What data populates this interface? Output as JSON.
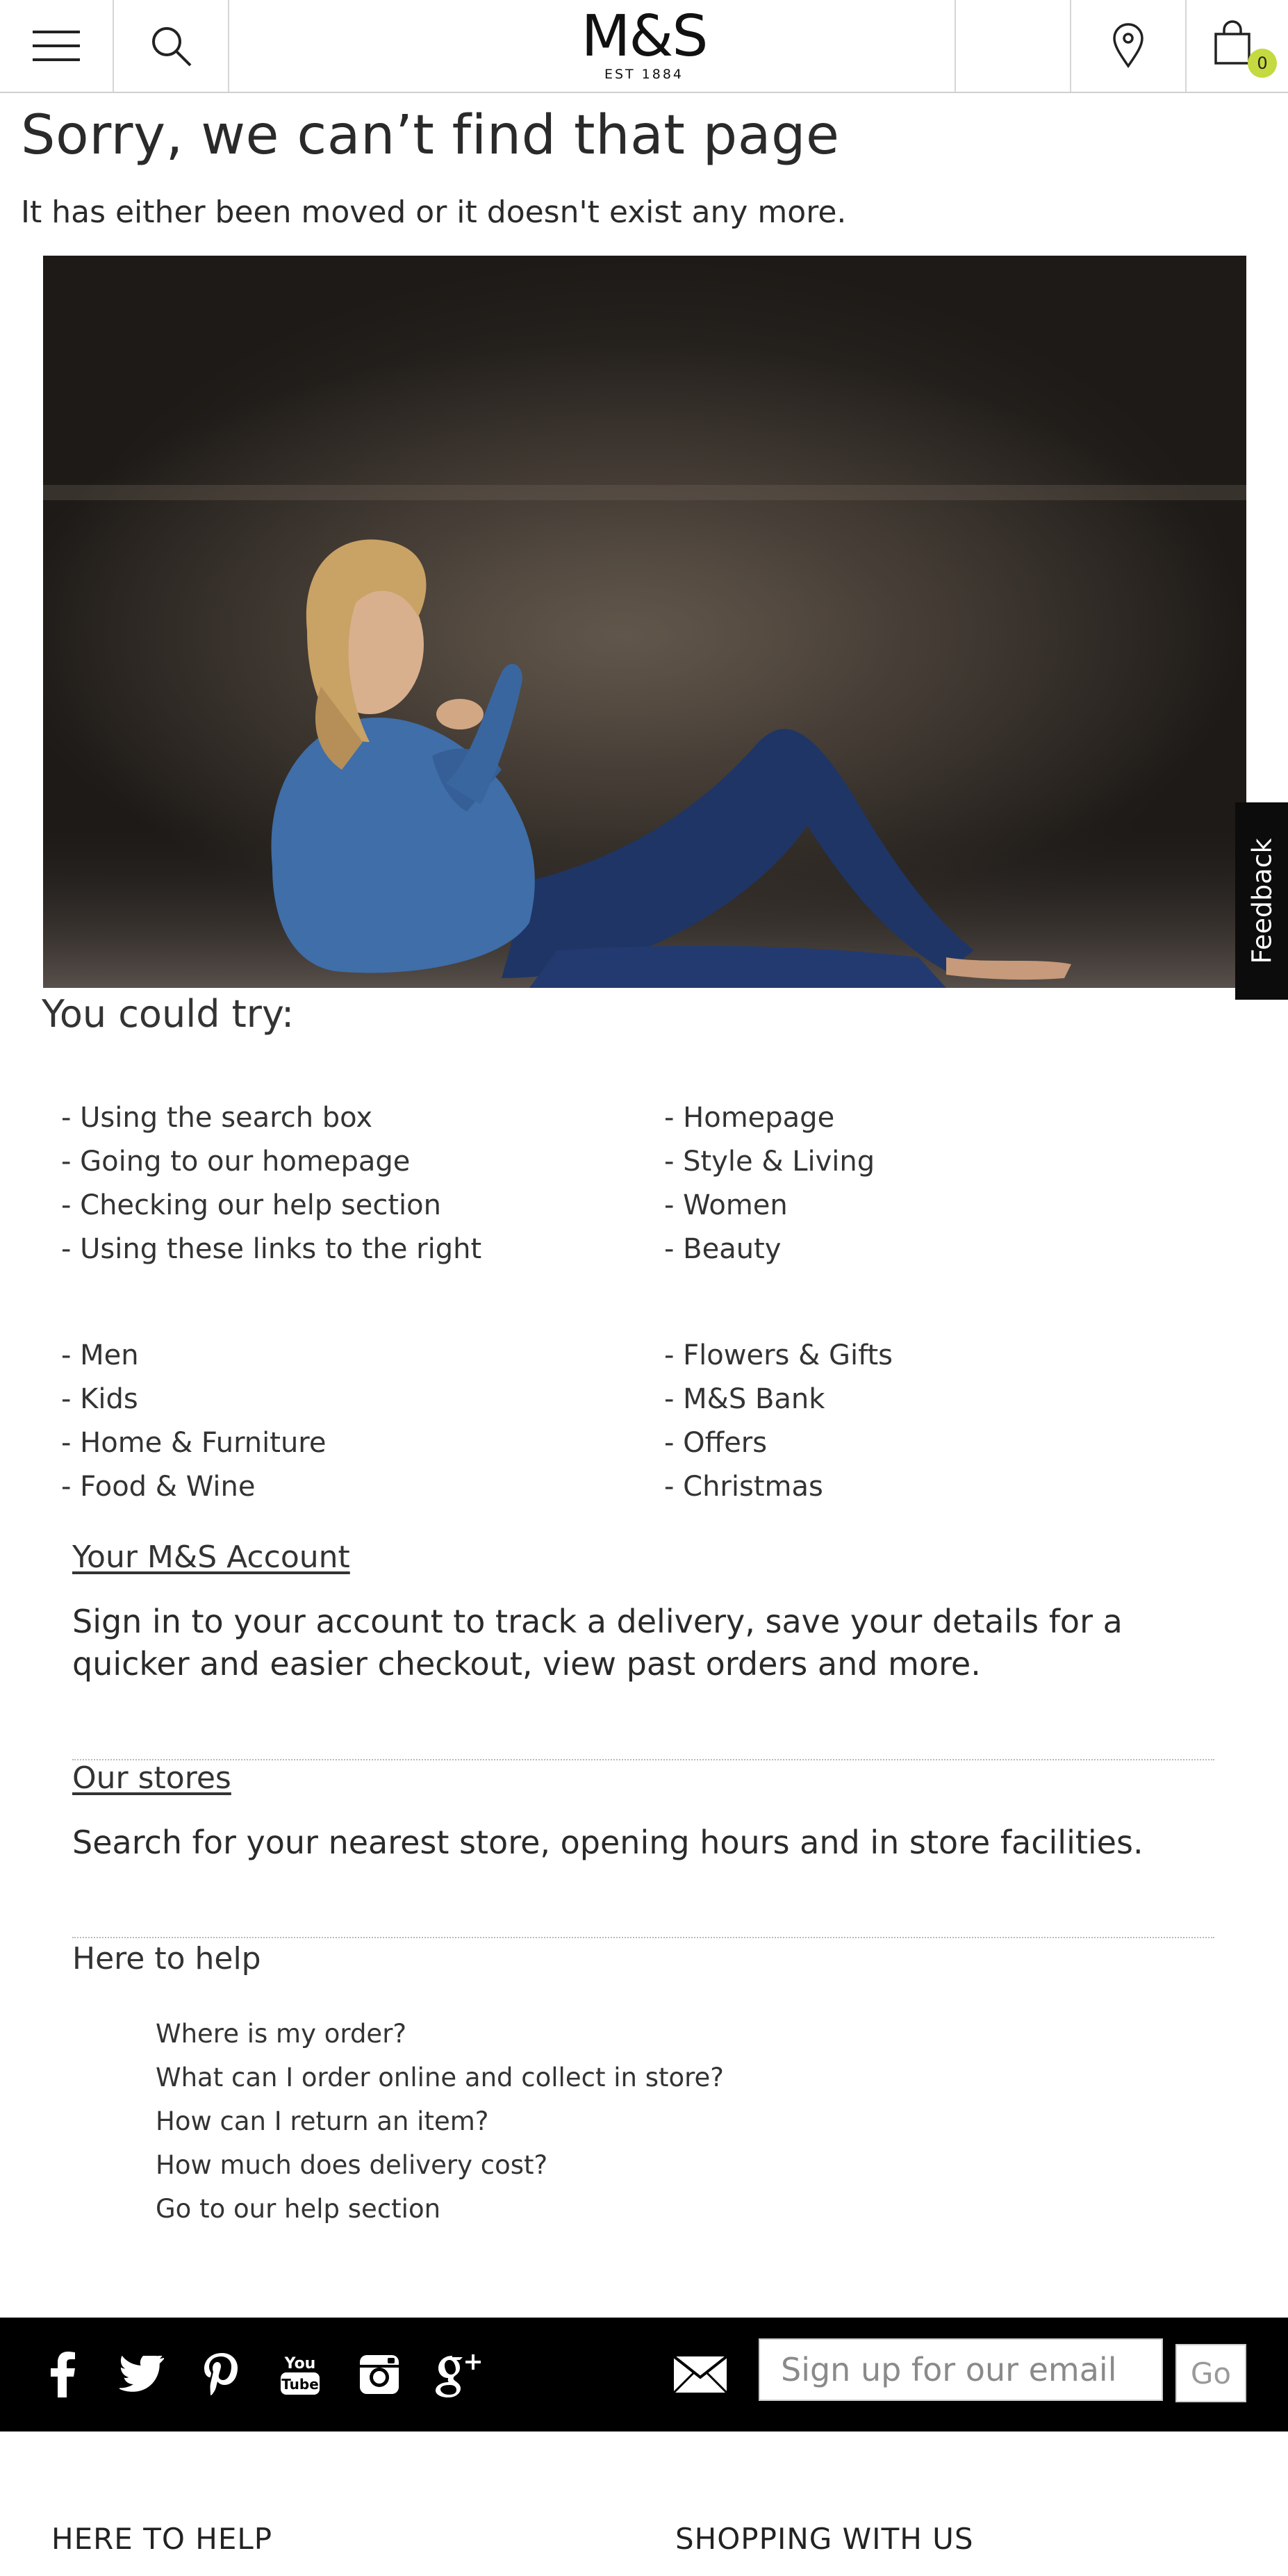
{
  "header": {
    "logo_main": "M&S",
    "logo_est": "EST 1884",
    "bag_count": "0",
    "icons": [
      "menu-icon",
      "search-icon",
      "store-locator-icon",
      "shopping-bag-icon"
    ]
  },
  "error": {
    "title": "Sorry, we can’t find that page",
    "subtitle": "It has either been moved or it doesn't exist any more."
  },
  "feedback_label": "Feedback",
  "suggestions": {
    "title": "You could try:",
    "tips": [
      "- Using the search box",
      "- Going to our homepage",
      "- Checking our help section",
      "- Using these links to the right"
    ],
    "links_a": [
      "- Homepage",
      "- Style & Living",
      "- Women",
      "- Beauty"
    ],
    "links_b": [
      "- Men",
      "- Kids",
      "- Home & Furniture",
      "- Food & Wine"
    ],
    "links_c": [
      "- Flowers & Gifts",
      "- M&S Bank",
      "- Offers",
      "- Christmas"
    ]
  },
  "account": {
    "title": "Your M&S Account",
    "text": "Sign in to your account to track a delivery, save your details for a quicker and easier checkout, view past orders and more."
  },
  "stores": {
    "title": "Our stores",
    "text": "Search for your nearest store, opening hours and in store facilities."
  },
  "help": {
    "title": "Here to help",
    "links": [
      "Where is my order?",
      "What can I order online and collect in store?",
      "How can I return an item?",
      "How much does delivery cost?",
      "Go to our help section"
    ]
  },
  "footer": {
    "social": [
      "facebook-icon",
      "twitter-icon",
      "pinterest-icon",
      "youtube-icon",
      "instagram-icon",
      "google-plus-icon"
    ],
    "youtube_text": "You",
    "youtube_tube": "Tube",
    "email_placeholder": "Sign up for our email",
    "go_label": "Go",
    "col1_heading": "HERE TO HELP",
    "col2_heading": "SHOPPING WITH US"
  },
  "colors": {
    "accent_badge": "#c5d940",
    "footer_bg": "#000000",
    "text": "#2a2a2a"
  }
}
